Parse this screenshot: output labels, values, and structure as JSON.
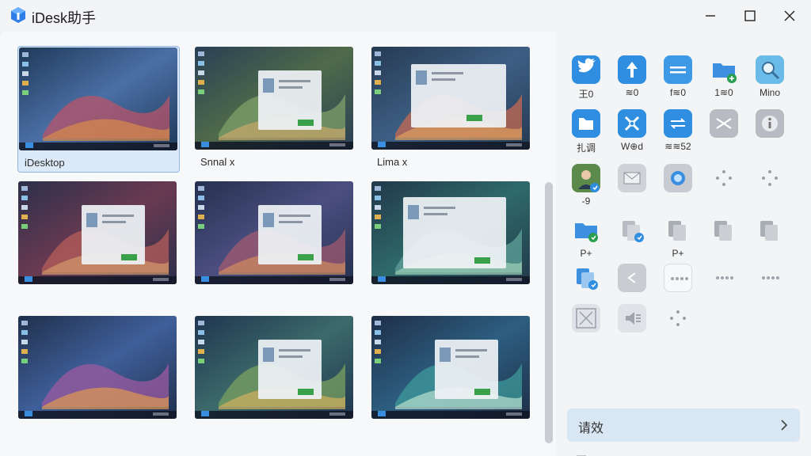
{
  "app": {
    "title": "iDesk助手"
  },
  "thumbnails": [
    {
      "label": "iDesktop",
      "selected": true
    },
    {
      "label": "Snnal x",
      "selected": false
    },
    {
      "label": "Lima x",
      "selected": false
    },
    {
      "label": "",
      "selected": false
    },
    {
      "label": "",
      "selected": false
    },
    {
      "label": "",
      "selected": false
    },
    {
      "label": "",
      "selected": false
    },
    {
      "label": "",
      "selected": false
    },
    {
      "label": "",
      "selected": false
    }
  ],
  "tiles": [
    {
      "icon": "twitter-bird-icon",
      "label": "王0"
    },
    {
      "icon": "arrow-up-icon",
      "label": "≋0"
    },
    {
      "icon": "minus-bar-icon",
      "label": "f≋0"
    },
    {
      "icon": "folder-add-icon",
      "label": "1≋0"
    },
    {
      "icon": "magnifier-icon",
      "label": "Mino"
    },
    {
      "icon": "folder-blue-icon",
      "label": "扎调"
    },
    {
      "icon": "tools-icon",
      "label": "W⊕d"
    },
    {
      "icon": "arrows-icon",
      "label": "≋≋52"
    },
    {
      "icon": "shuffle-icon",
      "label": ""
    },
    {
      "icon": "info-icon",
      "label": ""
    },
    {
      "icon": "avatar-icon",
      "label": "-9"
    },
    {
      "icon": "mail-icon",
      "label": ""
    },
    {
      "icon": "globe-icon",
      "label": ""
    },
    {
      "icon": "dots-icon",
      "label": ""
    },
    {
      "icon": "dots-icon",
      "label": ""
    },
    {
      "icon": "folder-share-icon",
      "label": "P+"
    },
    {
      "icon": "copy-badge-icon",
      "label": ""
    },
    {
      "icon": "copy-icon",
      "label": "P+"
    },
    {
      "icon": "copy-icon",
      "label": ""
    },
    {
      "icon": "copy-icon",
      "label": ""
    },
    {
      "icon": "copy-blue-icon",
      "label": ""
    },
    {
      "icon": "arrow-left-icon",
      "label": ""
    },
    {
      "icon": "more-icon",
      "label": ""
    },
    {
      "icon": "more-icon",
      "label": ""
    },
    {
      "icon": "more-icon",
      "label": ""
    },
    {
      "icon": "tool-box-icon",
      "label": ""
    },
    {
      "icon": "speaker-icon",
      "label": ""
    },
    {
      "icon": "dots-icon",
      "label": ""
    }
  ],
  "bottom_button": {
    "label": "请效"
  },
  "partial_label": "—"
}
